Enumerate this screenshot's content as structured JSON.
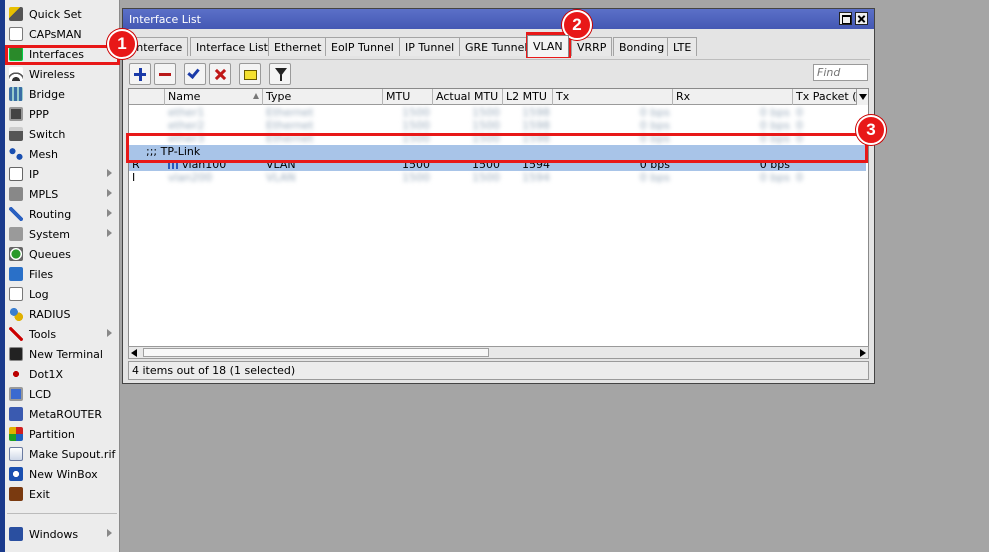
{
  "sidebar": {
    "items": [
      {
        "label": "Quick Set",
        "icon": "magic-wand-icon"
      },
      {
        "label": "CAPsMAN",
        "icon": "capsman-icon"
      },
      {
        "label": "Interfaces",
        "icon": "network-interfaces-icon"
      },
      {
        "label": "Wireless",
        "icon": "wireless-icon"
      },
      {
        "label": "Bridge",
        "icon": "bridge-icon"
      },
      {
        "label": "PPP",
        "icon": "ppp-icon"
      },
      {
        "label": "Switch",
        "icon": "switch-icon"
      },
      {
        "label": "Mesh",
        "icon": "mesh-icon"
      },
      {
        "label": "IP",
        "icon": "ip-icon",
        "submenu": true
      },
      {
        "label": "MPLS",
        "icon": "mpls-icon",
        "submenu": true
      },
      {
        "label": "Routing",
        "icon": "routing-icon",
        "submenu": true
      },
      {
        "label": "System",
        "icon": "system-gear-icon",
        "submenu": true
      },
      {
        "label": "Queues",
        "icon": "queues-icon"
      },
      {
        "label": "Files",
        "icon": "files-folder-icon"
      },
      {
        "label": "Log",
        "icon": "log-icon"
      },
      {
        "label": "RADIUS",
        "icon": "radius-icon"
      },
      {
        "label": "Tools",
        "icon": "tools-icon",
        "submenu": true
      },
      {
        "label": "New Terminal",
        "icon": "terminal-icon"
      },
      {
        "label": "Dot1X",
        "icon": "dot1x-icon"
      },
      {
        "label": "LCD",
        "icon": "lcd-icon"
      },
      {
        "label": "MetaROUTER",
        "icon": "metarouter-icon"
      },
      {
        "label": "Partition",
        "icon": "partition-pie-icon"
      },
      {
        "label": "Make Supout.rif",
        "icon": "supout-file-icon"
      },
      {
        "label": "New WinBox",
        "icon": "winbox-icon"
      },
      {
        "label": "Exit",
        "icon": "exit-door-icon"
      }
    ],
    "windows_item": {
      "label": "Windows",
      "icon": "windows-icon",
      "submenu": true
    }
  },
  "window": {
    "title": "Interface List",
    "tabs": [
      "Interface",
      "Interface List",
      "Ethernet",
      "EoIP Tunnel",
      "IP Tunnel",
      "GRE Tunnel",
      "VLAN",
      "VRRP",
      "Bonding",
      "LTE"
    ],
    "active_tab": "VLAN",
    "toolbar": {
      "buttons": [
        "add-icon",
        "remove-icon",
        "enable-check-icon",
        "disable-x-icon",
        "comment-icon",
        "filter-funnel-icon"
      ],
      "find_placeholder": "Find"
    },
    "table": {
      "columns": [
        "",
        "Name",
        "Type",
        "MTU",
        "Actual MTU",
        "L2 MTU",
        "Tx",
        "Rx",
        "Tx Packet (p"
      ],
      "blurred_rows_top": [
        [
          "",
          "ether1",
          "Ethernet",
          "1500",
          "1500",
          "1598",
          "0 bps",
          "0 bps",
          "0"
        ],
        [
          "",
          "ether2",
          "Ethernet",
          "1500",
          "1500",
          "1598",
          "0 bps",
          "0 bps",
          "0"
        ],
        [
          "",
          "ether3",
          "Ethernet",
          "1500",
          "1500",
          "1598",
          "0 bps",
          "0 bps",
          "0"
        ]
      ],
      "comment_row": ";;; TP-Link",
      "selected_row": {
        "flag": "R",
        "name": "vlan100",
        "type": "VLAN",
        "mtu": "1500",
        "actual_mtu": "1500",
        "l2_mtu": "1594",
        "tx": "0 bps",
        "rx": "0 bps",
        "tx_packet": ""
      },
      "blurred_rows_bottom": [
        [
          "I",
          "vlan200",
          "VLAN",
          "1500",
          "1500",
          "1594",
          "0 bps",
          "0 bps",
          "0"
        ]
      ]
    },
    "status": "4 items out of 18 (1 selected)"
  },
  "annotations": [
    {
      "number": "1",
      "target": "Interfaces"
    },
    {
      "number": "2",
      "target": "VLAN"
    },
    {
      "number": "3",
      "target": "vlan100"
    }
  ],
  "colors": {
    "highlight_red": "#e81818",
    "titlebar_blue": "#4a5ebc",
    "selection_blue": "#a8c4e8"
  }
}
